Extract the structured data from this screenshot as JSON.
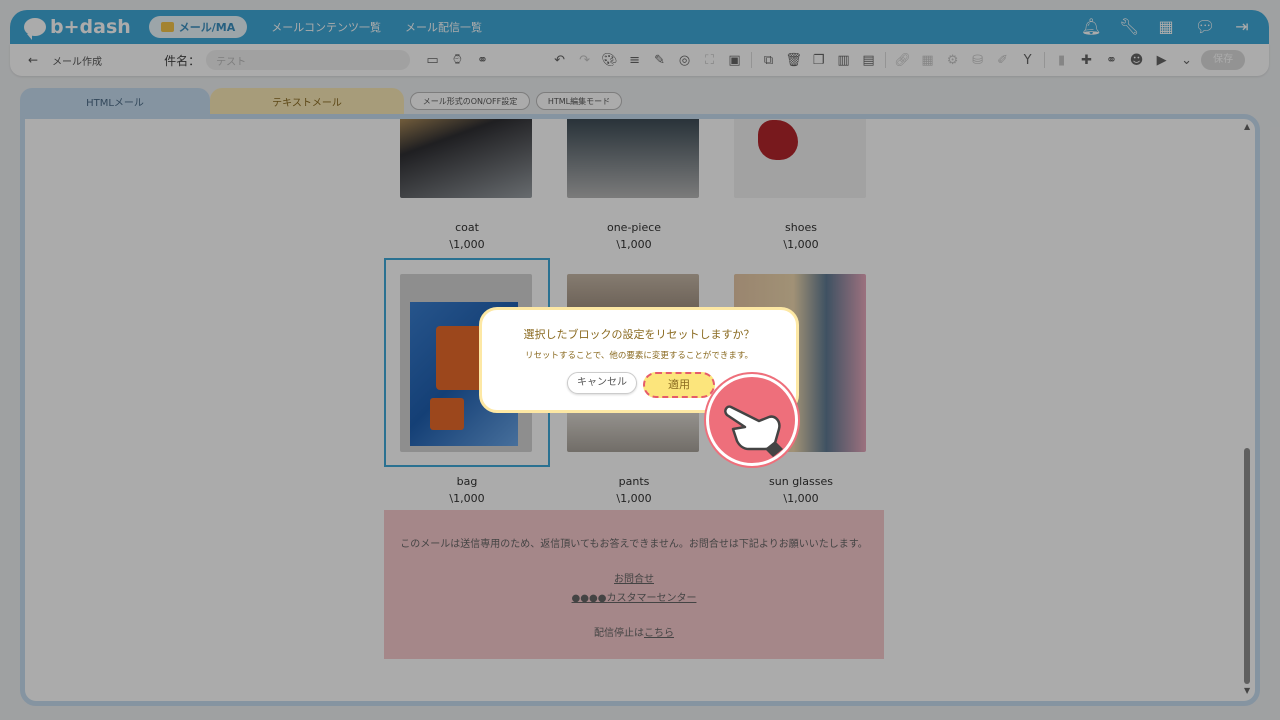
{
  "app": {
    "logo_text": "b+dash",
    "module_pill": "メール/MA",
    "nav": [
      "メールコンテンツ一覧",
      "メール配信一覧"
    ],
    "top_icons": [
      "bell-icon",
      "wrench-icon",
      "grid-icon",
      "chat-icon",
      "logout-icon"
    ]
  },
  "toolbar": {
    "back": "←",
    "breadcrumb": "メール作成",
    "subject_label": "件名：",
    "subject_value": "テスト",
    "save_label": "保存"
  },
  "tabs": {
    "html": "HTMLメール",
    "text": "テキストメール",
    "chip_onoff": "メール形式のON/OFF設定",
    "chip_htmledit": "HTML編集モード"
  },
  "products": [
    {
      "name": "coat",
      "price": "\\1,000"
    },
    {
      "name": "one-piece",
      "price": "\\1,000"
    },
    {
      "name": "shoes",
      "price": "\\1,000"
    },
    {
      "name": "bag",
      "price": "\\1,000"
    },
    {
      "name": "pants",
      "price": "\\1,000"
    },
    {
      "name": "sun glasses",
      "price": "\\1,000"
    }
  ],
  "footer": {
    "note": "このメールは送信専用のため、返信頂いてもお答えできません。お問合せは下記よりお願いいたします。",
    "contact": "お問合せ",
    "center": "●●●●カスタマーセンター",
    "unsub_prefix": "配信停止は",
    "unsub_link": "こちら"
  },
  "dialog": {
    "title": "選択したブロックの設定をリセットしますか？",
    "message": "リセットすることで、他の要素に変更することができます。",
    "cancel": "キャンセル",
    "apply": "適用"
  },
  "colors": {
    "brand": "#3fa9d8",
    "dialog_border": "#fde8a4",
    "apply_bg": "#fce57c",
    "highlight": "#e65c6a",
    "footer_bg": "#f7c9cd"
  }
}
